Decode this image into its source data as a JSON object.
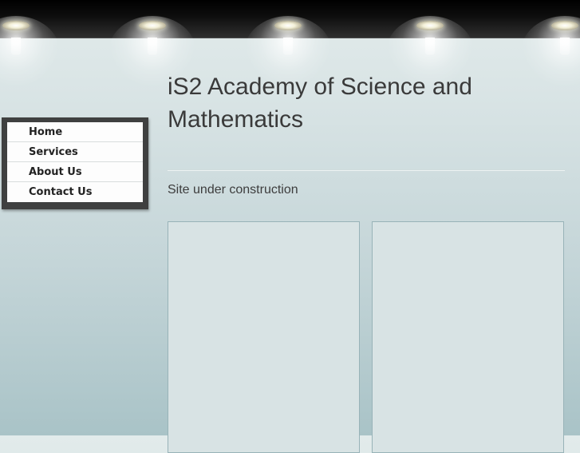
{
  "header": {
    "lights": [
      "spotlight",
      "spotlight",
      "spotlight",
      "spotlight",
      "spotlight"
    ]
  },
  "nav": {
    "items": [
      {
        "label": "Home"
      },
      {
        "label": "Services"
      },
      {
        "label": "About Us"
      },
      {
        "label": "Contact Us"
      }
    ]
  },
  "main": {
    "title": "iS2 Academy of Science and Mathematics",
    "subtitle": "Site under construction"
  },
  "colors": {
    "top_bar": "#000000",
    "menu_frame": "#3f4040",
    "menu_bg": "#fdfdfd",
    "panel_bg": "#d8e3e4",
    "panel_border": "#98b3b8",
    "text": "#3a3a3a"
  }
}
